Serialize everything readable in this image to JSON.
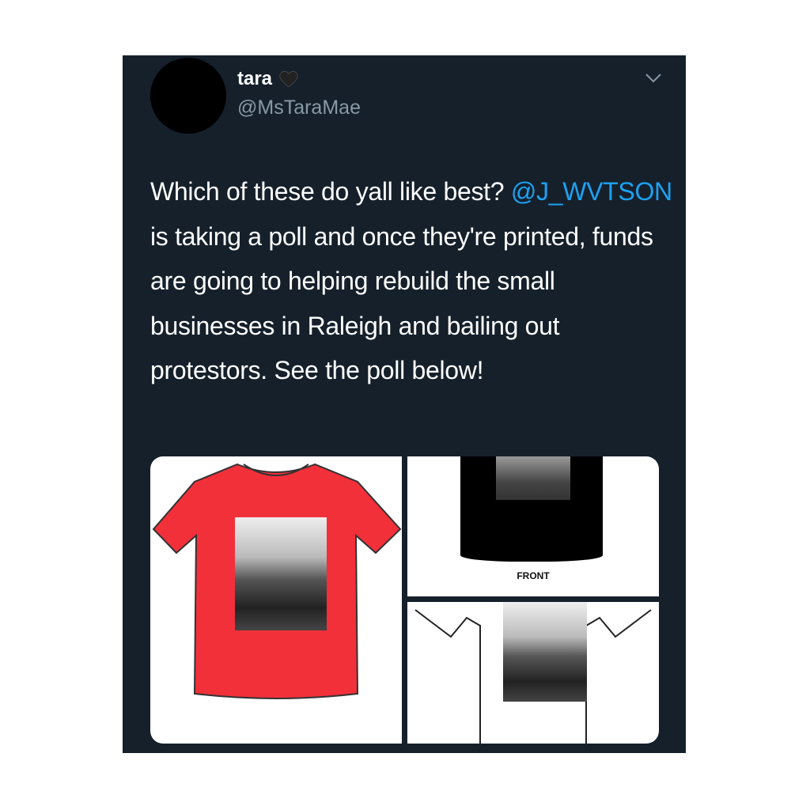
{
  "tweet": {
    "display_name": "tara",
    "emoji_icon": "black-heart-icon",
    "handle": "@MsTaraMae",
    "text_before": "Which of these do yall like best? ",
    "mention": "@J_WVTSON",
    "text_after": " is taking a poll and once they're printed, funds are going to helping rebuild the small businesses in Raleigh and bailing out protestors. See the poll below!"
  },
  "media": {
    "front_label": "FRONT"
  },
  "colors": {
    "background": "#15202b",
    "mention": "#1da1f2",
    "handle": "#8899a6",
    "red_shirt": "#f2303a"
  }
}
